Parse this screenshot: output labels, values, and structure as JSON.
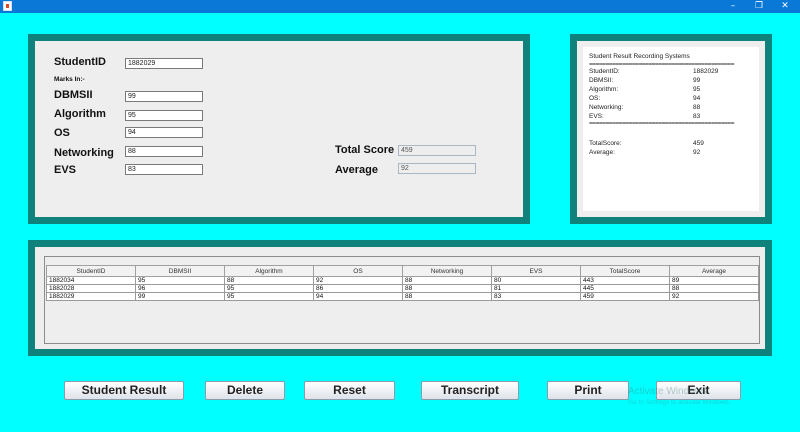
{
  "window": {
    "minimize_glyph": "–",
    "maximize_glyph": "❐",
    "close_glyph": "✕"
  },
  "form": {
    "student_id_label": "StudentID",
    "student_id_value": "1882029",
    "marks_in_label": "Marks In:-",
    "dbmsii_label": "DBMSII",
    "dbmsii_value": "99",
    "algorithm_label": "Algorithm",
    "algorithm_value": "95",
    "os_label": "OS",
    "os_value": "94",
    "networking_label": "Networking",
    "networking_value": "88",
    "evs_label": "EVS",
    "evs_value": "83",
    "total_score_label": "Total Score",
    "total_score_value": "459",
    "average_label": "Average",
    "average_value": "92"
  },
  "receipt": {
    "title": "Student Result Recording Systems",
    "separator1": "============================================",
    "lines": [
      {
        "key": "StudentID:",
        "value": "1882029"
      },
      {
        "key": "DBMSII:",
        "value": "99"
      },
      {
        "key": "Algorithm:",
        "value": "95"
      },
      {
        "key": "OS:",
        "value": "94"
      },
      {
        "key": "Networking:",
        "value": "88"
      },
      {
        "key": "EVS:",
        "value": "83"
      }
    ],
    "separator2": "============================================",
    "total_key": "TotalScore:",
    "total_value": "459",
    "average_key": "Average:",
    "average_value": "92"
  },
  "table": {
    "columns": [
      "StudentID",
      "DBMSII",
      "Algorithm",
      "OS",
      "Networking",
      "EVS",
      "TotalScore",
      "Average"
    ],
    "rows": [
      [
        "1882034",
        "95",
        "88",
        "92",
        "88",
        "80",
        "443",
        "89"
      ],
      [
        "1882028",
        "96",
        "95",
        "86",
        "88",
        "81",
        "445",
        "88"
      ],
      [
        "1882029",
        "99",
        "95",
        "94",
        "88",
        "83",
        "459",
        "92"
      ]
    ]
  },
  "buttons": {
    "student_result": "Student Result",
    "delete": "Delete",
    "reset": "Reset",
    "transcript": "Transcript",
    "print": "Print",
    "exit": "Exit"
  },
  "watermark": {
    "title": "Activate Windows",
    "subtitle": "Go to Settings to activate Windows."
  }
}
